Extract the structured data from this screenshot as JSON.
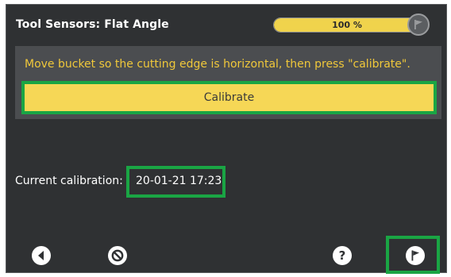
{
  "header": {
    "title": "Tool Sensors: Flat Angle",
    "progress_text": "100 %",
    "progress_fraction": 1.0,
    "progress_icon": "flag-icon"
  },
  "panel": {
    "instruction": "Move bucket so the cutting edge is horizontal, then press \"calibrate\".",
    "calibrate_label": "Calibrate"
  },
  "calibration": {
    "label": "Current calibration:",
    "value": "20-01-21 17:23"
  },
  "footer": {
    "back_icon": "back-arrow-icon",
    "cancel_icon": "cancel-icon",
    "help_icon": "help-icon",
    "finish_icon": "flag-icon"
  },
  "colors": {
    "background": "#2f3133",
    "panel": "#4b4d50",
    "accent_yellow": "#f6d756",
    "instruction_text": "#f0c83a",
    "highlight_green": "#1aa544"
  }
}
